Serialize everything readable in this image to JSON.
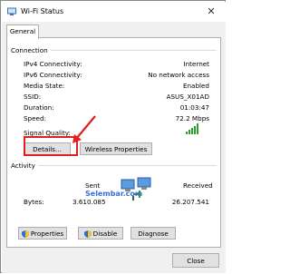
{
  "window": {
    "title": "Wi-Fi Status",
    "close_glyph": "✕"
  },
  "tabs": [
    {
      "label": "General"
    }
  ],
  "connection": {
    "section_label": "Connection",
    "rows": [
      {
        "label": "IPv4 Connectivity:",
        "value": "Internet"
      },
      {
        "label": "IPv6 Connectivity:",
        "value": "No network access"
      },
      {
        "label": "Media State:",
        "value": "Enabled"
      },
      {
        "label": "SSID:",
        "value": "ASUS_X01AD"
      },
      {
        "label": "Duration:",
        "value": "01:03:47"
      },
      {
        "label": "Speed:",
        "value": "72.2 Mbps"
      }
    ],
    "signal_label": "Signal Quality:",
    "signal_bars_lit": 5,
    "details_button": "Details...",
    "wireless_button": "Wireless Properties"
  },
  "activity": {
    "section_label": "Activity",
    "sent_label": "Sent",
    "received_label": "Received",
    "bytes_label": "Bytes:",
    "bytes_sent": "3.610.085",
    "bytes_received": "26.207.541"
  },
  "watermark": "Selembar.com",
  "buttons": {
    "properties": "Properties",
    "disable": "Disable",
    "diagnose": "Diagnose",
    "close": "Close"
  },
  "colors": {
    "signal_green": "#2e9d2e",
    "arrow_red": "#e02020",
    "shield_blue": "#2a6fd1"
  }
}
